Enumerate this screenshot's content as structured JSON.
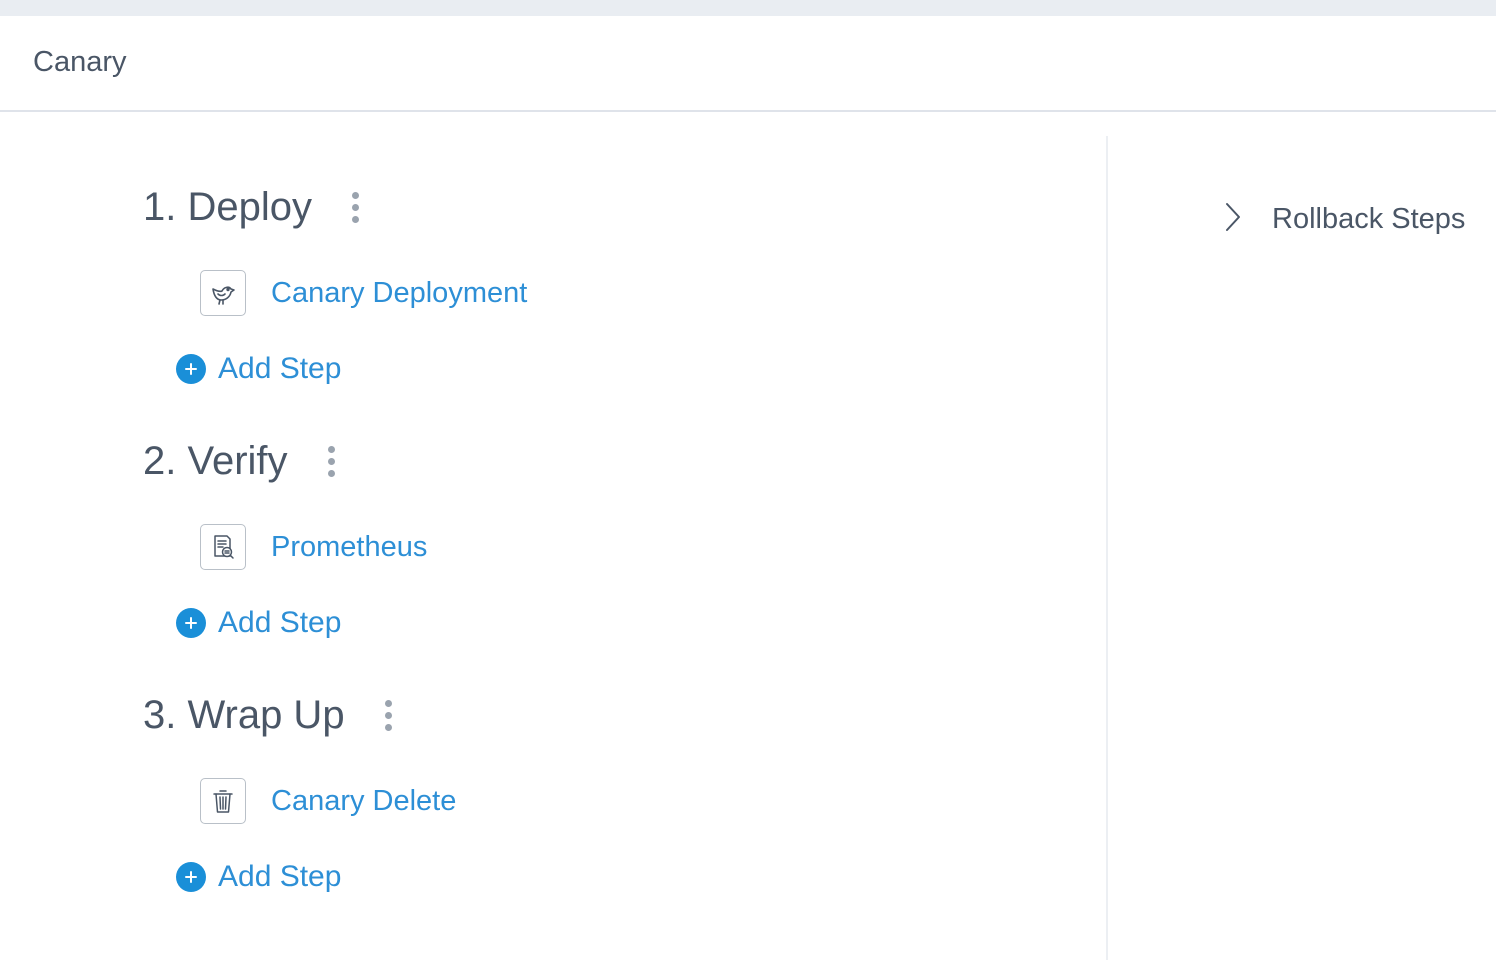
{
  "header": {
    "title": "Canary"
  },
  "sections": [
    {
      "title": "1. Deploy",
      "steps": [
        {
          "label": "Canary Deployment",
          "icon": "canary-bird-icon"
        }
      ],
      "add_step_label": "Add Step"
    },
    {
      "title": "2. Verify",
      "steps": [
        {
          "label": "Prometheus",
          "icon": "document-search-icon"
        }
      ],
      "add_step_label": "Add Step"
    },
    {
      "title": "3. Wrap Up",
      "steps": [
        {
          "label": "Canary Delete",
          "icon": "trash-icon"
        }
      ],
      "add_step_label": "Add Step"
    }
  ],
  "rollback": {
    "label": "Rollback Steps",
    "icon": "chevron-right-icon"
  },
  "colors": {
    "link": "#2d8fd6",
    "accent": "#1a8fd8",
    "text": "#4a5666",
    "top_strip": "#e9edf2"
  }
}
